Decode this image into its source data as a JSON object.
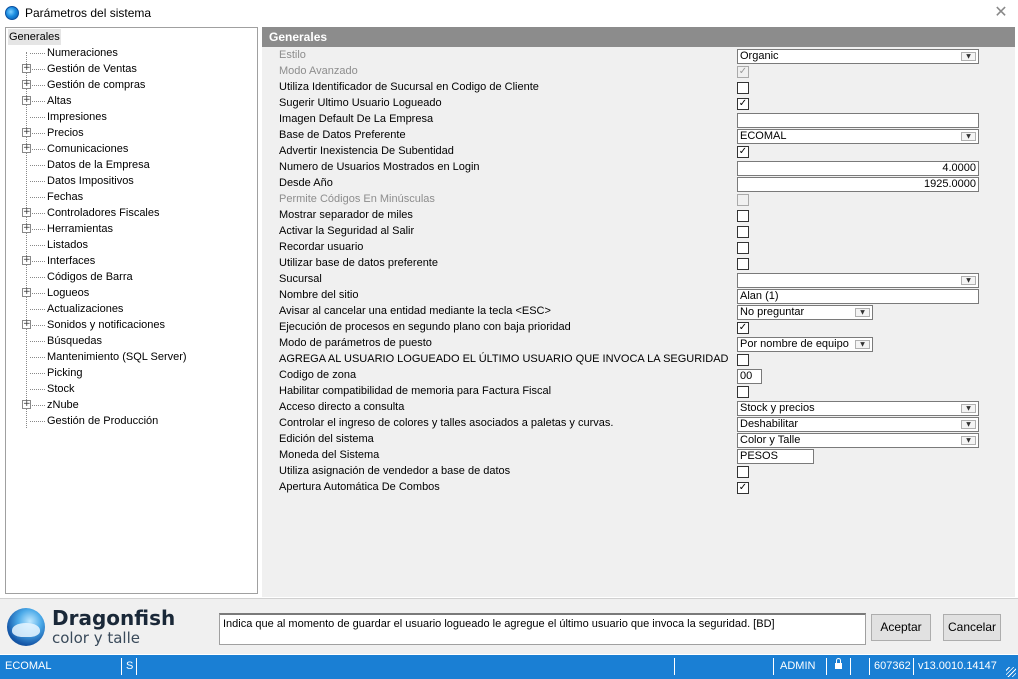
{
  "window": {
    "title": "Parámetros del sistema",
    "close_glyph": "✕"
  },
  "tree": {
    "root": "Generales",
    "items": [
      {
        "label": "Numeraciones",
        "expandable": false
      },
      {
        "label": "Gestión de Ventas",
        "expandable": true
      },
      {
        "label": "Gestión de compras",
        "expandable": true
      },
      {
        "label": "Altas",
        "expandable": true
      },
      {
        "label": "Impresiones",
        "expandable": false
      },
      {
        "label": "Precios",
        "expandable": true
      },
      {
        "label": "Comunicaciones",
        "expandable": true
      },
      {
        "label": "Datos de la Empresa",
        "expandable": false
      },
      {
        "label": "Datos Impositivos",
        "expandable": false
      },
      {
        "label": "Fechas",
        "expandable": false
      },
      {
        "label": "Controladores Fiscales",
        "expandable": true
      },
      {
        "label": "Herramientas",
        "expandable": true
      },
      {
        "label": "Listados",
        "expandable": false
      },
      {
        "label": "Interfaces",
        "expandable": true
      },
      {
        "label": "Códigos de Barra",
        "expandable": false
      },
      {
        "label": "Logueos",
        "expandable": true
      },
      {
        "label": "Actualizaciones",
        "expandable": false
      },
      {
        "label": "Sonidos y notificaciones",
        "expandable": true
      },
      {
        "label": "Búsquedas",
        "expandable": false
      },
      {
        "label": "Mantenimiento (SQL Server)",
        "expandable": false
      },
      {
        "label": "Picking",
        "expandable": false
      },
      {
        "label": "Stock",
        "expandable": false
      },
      {
        "label": "zNube",
        "expandable": true
      },
      {
        "label": "Gestión de Producción",
        "expandable": false
      }
    ]
  },
  "panel": {
    "header": "Generales",
    "rows": [
      {
        "label": "Estilo",
        "type": "combo",
        "value": "Organic",
        "disabled": true
      },
      {
        "label": "Modo Avanzado",
        "type": "check",
        "checked": true,
        "disabled": true
      },
      {
        "label": "Utiliza Identificador de Sucursal en Codigo de Cliente",
        "type": "check",
        "checked": false
      },
      {
        "label": "Sugerir Ultimo Usuario Logueado",
        "type": "check",
        "checked": true
      },
      {
        "label": "Imagen Default De La Empresa",
        "type": "text",
        "value": ""
      },
      {
        "label": "Base de Datos Preferente",
        "type": "combo",
        "value": "ECOMAL"
      },
      {
        "label": "Advertir Inexistencia De Subentidad",
        "type": "check",
        "checked": true
      },
      {
        "label": "Numero de Usuarios Mostrados en Login",
        "type": "number",
        "value": "4.0000"
      },
      {
        "label": "Desde Año",
        "type": "number",
        "value": "1925.0000"
      },
      {
        "label": "Permite Códigos En Minúsculas",
        "type": "check",
        "checked": false,
        "disabled": true
      },
      {
        "label": "Mostrar separador de miles",
        "type": "check",
        "checked": false
      },
      {
        "label": "Activar la Seguridad al Salir",
        "type": "check",
        "checked": false
      },
      {
        "label": "Recordar usuario",
        "type": "check",
        "checked": false
      },
      {
        "label": "Utilizar base de datos preferente",
        "type": "check",
        "checked": false
      },
      {
        "label": "Sucursal",
        "type": "combo",
        "value": ""
      },
      {
        "label": "Nombre del sitio",
        "type": "text",
        "value": "Alan (1)"
      },
      {
        "label": "Avisar al cancelar una entidad mediante la tecla <ESC>",
        "type": "combo-short",
        "value": "No preguntar"
      },
      {
        "label": "Ejecución de procesos en segundo plano con baja prioridad",
        "type": "check",
        "checked": true
      },
      {
        "label": "Modo de parámetros de puesto",
        "type": "combo-short",
        "value": "Por nombre de equipo"
      },
      {
        "label": "AGREGA AL USUARIO LOGUEADO EL ÚLTIMO USUARIO QUE INVOCA LA SEGURIDAD",
        "type": "check",
        "checked": false
      },
      {
        "label": "Codigo de zona",
        "type": "text-xs",
        "value": "00"
      },
      {
        "label": "Habilitar compatibilidad de memoria para Factura Fiscal",
        "type": "check",
        "checked": false
      },
      {
        "label": "Acceso directo a consulta",
        "type": "combo",
        "value": "Stock y precios"
      },
      {
        "label": "Controlar el ingreso de colores y talles asociados a paletas y curvas.",
        "type": "combo",
        "value": "Deshabilitar"
      },
      {
        "label": "Edición del sistema",
        "type": "combo",
        "value": "Color y Talle"
      },
      {
        "label": "Moneda del Sistema",
        "type": "text-sm",
        "value": "PESOS"
      },
      {
        "label": "Utiliza asignación de vendedor a base de datos",
        "type": "check",
        "checked": false
      },
      {
        "label": "Apertura Automática De Combos",
        "type": "check",
        "checked": true
      }
    ]
  },
  "footer": {
    "logo_name": "Dragonfish",
    "logo_sub": "color y talle",
    "description": "Indica que al momento de guardar el usuario logueado le agregue el último usuario que invoca la seguridad. [BD]",
    "accept_label": "Aceptar",
    "cancel_label": "Cancelar"
  },
  "statusbar": {
    "database": "ECOMAL",
    "mode": "S",
    "user": "ADMIN",
    "serial": "607362",
    "version": "v13.0010.14147"
  },
  "colors": {
    "status_bar": "#1a7fd4",
    "panel_header": "#8c8c8c",
    "panel_bg": "#f0f0f0"
  }
}
